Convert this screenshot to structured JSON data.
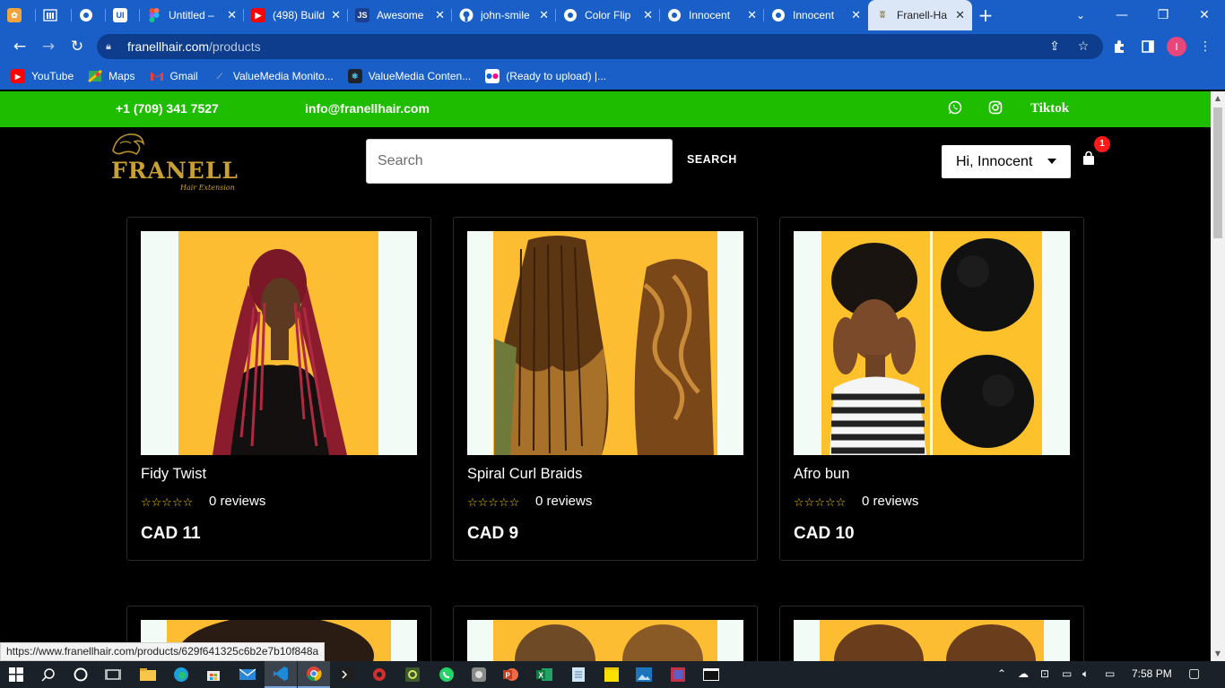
{
  "browser": {
    "tabs": [
      {
        "title": "",
        "icon": "app-icon",
        "color": "#f2a33a"
      },
      {
        "title": "",
        "icon": "bank-icon",
        "color": "#ffffff"
      },
      {
        "title": "",
        "icon": "globe-icon",
        "color": "#ffffff"
      },
      {
        "title": "UI",
        "icon": "ui-icon",
        "color": "#ffffff"
      },
      {
        "title": "Untitled –",
        "icon": "figma-icon",
        "color": "#f24e1e"
      },
      {
        "title": "(498) Build",
        "icon": "youtube-icon",
        "color": "#ff0000"
      },
      {
        "title": "Awesome",
        "icon": "js-icon",
        "color": "#1d3f8f"
      },
      {
        "title": "john-smile",
        "icon": "github-icon",
        "color": "#000000"
      },
      {
        "title": "Color Flip",
        "icon": "globe-icon",
        "color": "#ffffff"
      },
      {
        "title": "Innocent",
        "icon": "globe-icon",
        "color": "#ffffff"
      },
      {
        "title": "Innocent",
        "icon": "globe-icon",
        "color": "#ffffff"
      },
      {
        "title": "Franell-Ha",
        "icon": "franell-icon",
        "color": "#8a7a40"
      }
    ],
    "url_domain": "franellhair.com",
    "url_path": "/products",
    "bookmarks": [
      {
        "label": "YouTube",
        "icon": "youtube-icon",
        "color": "#ff0000"
      },
      {
        "label": "Maps",
        "icon": "maps-icon",
        "color": "#34a853"
      },
      {
        "label": "Gmail",
        "icon": "gmail-icon",
        "color": "#ea4335"
      },
      {
        "label": "ValueMedia Monito...",
        "icon": "valuemedia-icon",
        "color": "#6b7280"
      },
      {
        "label": "ValueMedia Conten...",
        "icon": "react-icon",
        "color": "#61dafb"
      },
      {
        "label": "(Ready to upload) |...",
        "icon": "flickr-icon",
        "color": "#ff0084"
      }
    ],
    "profile_initial": "I",
    "status_url": "https://www.franellhair.com/products/629f641325c6b2e7b10f848a"
  },
  "site": {
    "phone": "+1 (709) 341 7527",
    "email": "info@franellhair.com",
    "tiktok_label": "Tiktok",
    "logo_text": "FRANELL",
    "logo_sub": "Hair Extension",
    "search_placeholder": "Search",
    "search_button": "SEARCH",
    "user_greeting": "Hi, Innocent",
    "cart_count": "1",
    "accent_green": "#1fbd00"
  },
  "products": [
    {
      "name": "Fidy Twist",
      "reviews": "0 reviews",
      "price": "CAD 11",
      "rating": 0
    },
    {
      "name": "Spiral Curl Braids",
      "reviews": "0 reviews",
      "price": "CAD 9",
      "rating": 0
    },
    {
      "name": "Afro bun",
      "reviews": "0 reviews",
      "price": "CAD 10",
      "rating": 0
    }
  ],
  "taskbar": {
    "time": "7:58 PM"
  }
}
